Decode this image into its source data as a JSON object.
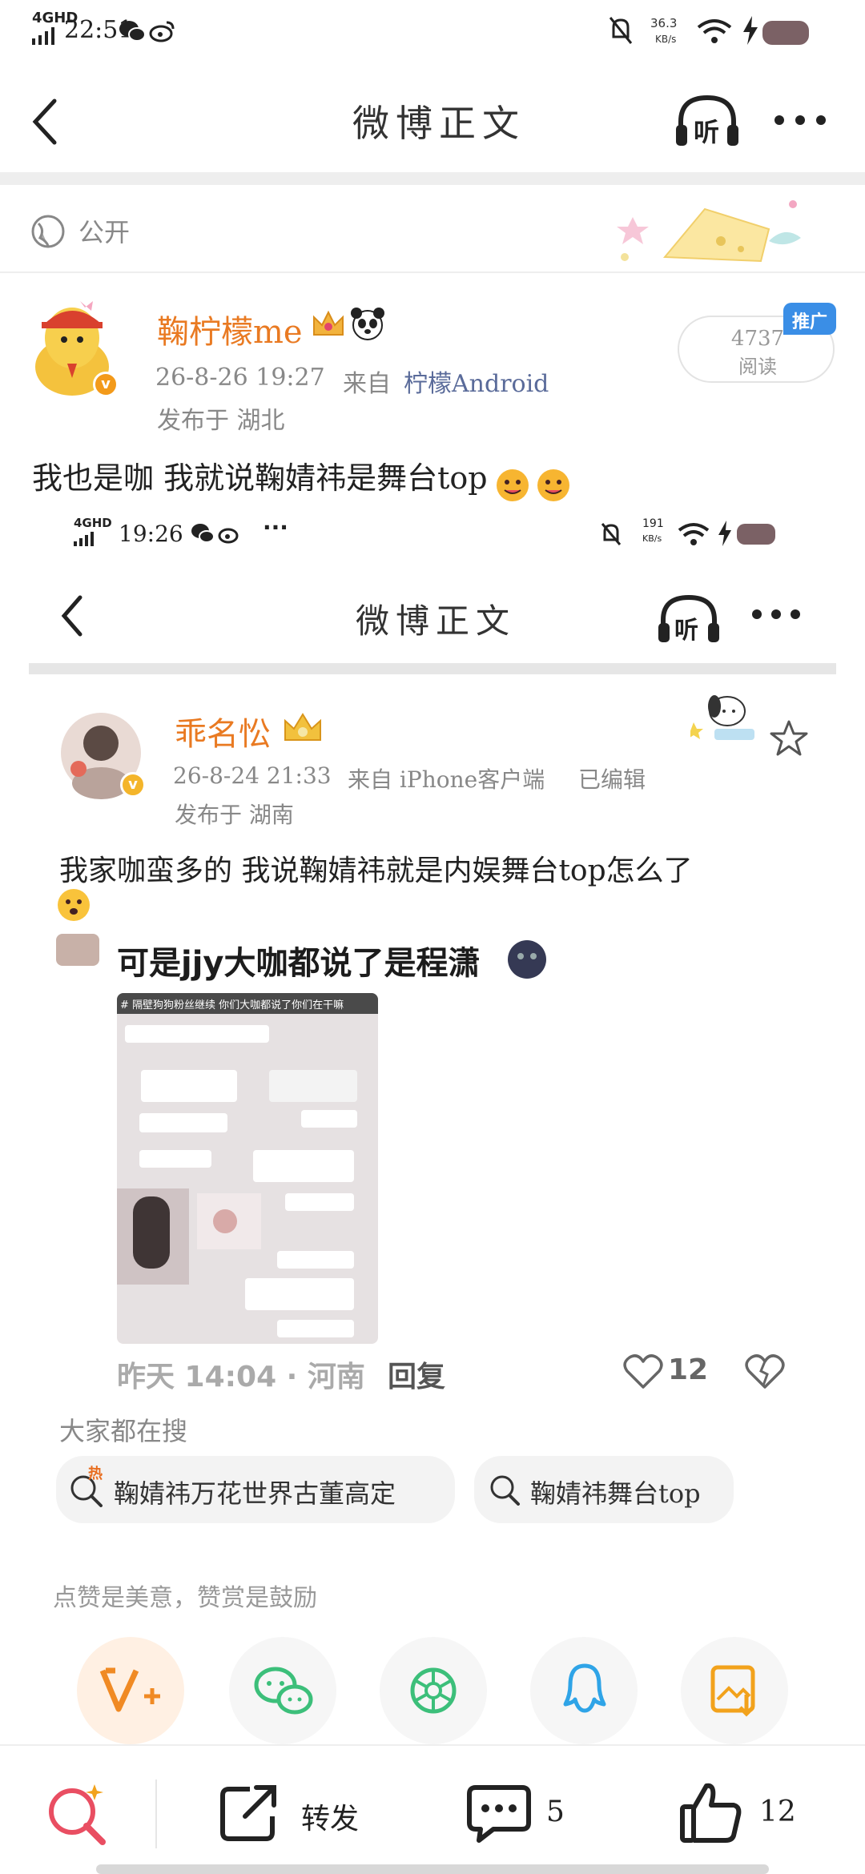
{
  "outer_status": {
    "network": "4GHD",
    "time": "22:51",
    "speed": "36.3",
    "speed_unit": "KB/s"
  },
  "outer_nav": {
    "title": "微博正文",
    "listen_label": "听"
  },
  "privacy": {
    "label": "公开"
  },
  "post": {
    "username": "鞠柠檬me",
    "reads_count": "4737",
    "reads_label": "阅读",
    "promo_badge": "推广",
    "meta_time": "26-8-26 19:27",
    "meta_from": "来自",
    "meta_client": "柠檬Android",
    "location": "发布于 湖北",
    "text": "我也是咖 我就说鞠婧祎是舞台top"
  },
  "inner_status": {
    "network": "4GHD",
    "time": "19:26",
    "dots": "···",
    "speed": "191",
    "speed_unit": "KB/s"
  },
  "inner_nav": {
    "title": "微博正文",
    "listen_label": "听"
  },
  "inner_post": {
    "username": "乖名忪",
    "meta_time": "26-8-24 21:33",
    "meta_from": "来自 iPhone客户端",
    "meta_edited": "已编辑",
    "location": "发布于 湖南",
    "text": "我家咖蛮多的 我说鞠婧祎就是内娱舞台top怎么了"
  },
  "comment": {
    "text": "可是jjy大咖都说了是程潇",
    "screenshot_caption": "# 隔壁狗狗粉丝继续 你们大咖都说了你们在干嘛",
    "time_loc": "昨天 14:04 · 河南",
    "reply_label": "回复",
    "like_count": "12"
  },
  "search": {
    "heading": "大家都在搜",
    "items": [
      {
        "label": "鞠婧祎万花世界古董高定",
        "tag": "热"
      },
      {
        "label": "鞠婧祎舞台top"
      }
    ]
  },
  "tip": {
    "text": "点赞是美意，赞赏是鼓励"
  },
  "share": [
    "v-plus-icon",
    "wechat-icon",
    "moments-icon",
    "qq-icon",
    "save-image-icon"
  ],
  "bottom": {
    "repost_label": "转发",
    "comment_count": "5",
    "like_count": "12"
  },
  "colors": {
    "accent": "#e97a22",
    "promo": "#3a8ee6",
    "share_wechat": "#3cbf7a",
    "share_qq": "#2fa4e7",
    "share_save": "#f2a21c"
  }
}
